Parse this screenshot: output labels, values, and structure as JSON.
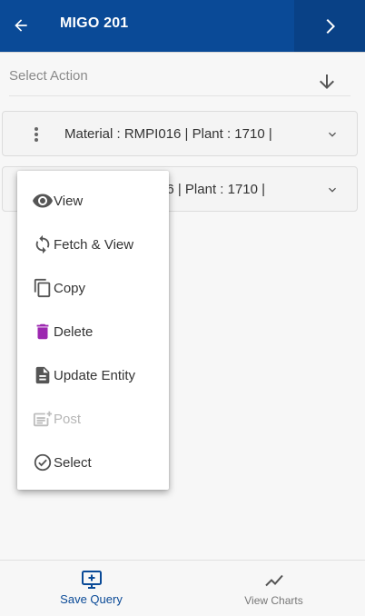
{
  "colors": {
    "header_bg": "#0a4a97",
    "delete_icon": "#9c27b0",
    "active_tab": "#0a4a97"
  },
  "header": {
    "title": "MIGO 201",
    "back_icon": "arrow-left-icon",
    "forward_icon": "chevron-right-icon"
  },
  "select_action": {
    "placeholder": "Select Action",
    "icon": "arrow-down-icon"
  },
  "rows": [
    {
      "text": "Material : RMPI016 | Plant : 1710 |"
    },
    {
      "text": "16 | Plant : 1710 |"
    }
  ],
  "menu": {
    "items": [
      {
        "label": "View",
        "icon": "eye-icon",
        "enabled": true
      },
      {
        "label": "Fetch & View",
        "icon": "refresh-icon",
        "enabled": true
      },
      {
        "label": "Copy",
        "icon": "copy-icon",
        "enabled": true
      },
      {
        "label": "Delete",
        "icon": "trash-icon",
        "enabled": true
      },
      {
        "label": "Update Entity",
        "icon": "document-icon",
        "enabled": true
      },
      {
        "label": "Post",
        "icon": "post-icon",
        "enabled": false
      },
      {
        "label": "Select",
        "icon": "check-circle-icon",
        "enabled": true
      }
    ]
  },
  "bottom_tabs": [
    {
      "label": "Save Query",
      "icon": "add-to-screen-icon",
      "active": true
    },
    {
      "label": "View Charts",
      "icon": "line-chart-icon",
      "active": false
    }
  ]
}
